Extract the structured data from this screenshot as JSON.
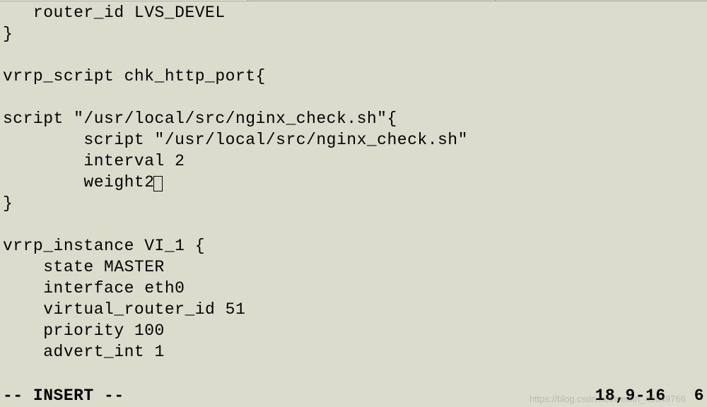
{
  "editor": {
    "lines": [
      "   router_id LVS_DEVEL",
      "}",
      "",
      "vrrp_script chk_http_port{",
      "",
      "script \"/usr/local/src/nginx_check.sh\"{",
      "        script \"/usr/local/src/nginx_check.sh\"",
      "        interval 2",
      "        weight2",
      "}",
      "",
      "vrrp_instance VI_1 {",
      "    state MASTER",
      "    interface eth0",
      "    virtual_router_id 51",
      "    priority 100",
      "    advert_int 1"
    ],
    "cursor_line_index": 8
  },
  "status": {
    "mode": "-- INSERT --",
    "position": "18,9-16",
    "scroll": "6"
  },
  "watermark": "https://blog.csdn.net/weixin_45649766"
}
